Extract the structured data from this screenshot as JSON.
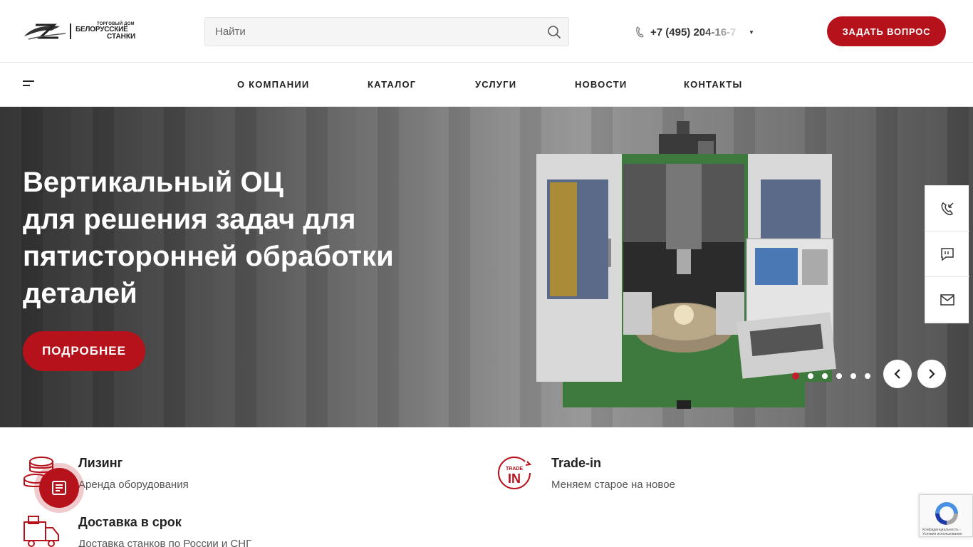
{
  "header": {
    "logo": {
      "small": "ТОРГОВЫЙ ДОМ",
      "line1": "БЕЛОРУССКИЕ",
      "line2": "СТАНКИ"
    },
    "search": {
      "placeholder": "Найти"
    },
    "phone": "+7 (495) 204-16-7",
    "ask_button": "ЗАДАТЬ ВОПРОС"
  },
  "nav": {
    "items": [
      "О КОМПАНИИ",
      "КАТАЛОГ",
      "УСЛУГИ",
      "НОВОСТИ",
      "КОНТАКТЫ"
    ]
  },
  "hero": {
    "title_lines": [
      "Вертикальный ОЦ",
      "для решения задач для",
      "пятисторонней обработки",
      "деталей"
    ],
    "button": "ПОДРОБНЕЕ",
    "slide_count": 6,
    "active_slide": 1
  },
  "features": [
    {
      "title": "Лизинг",
      "subtitle": "Аренда оборудования",
      "icon": "coins-stack-icon"
    },
    {
      "title": "Trade-in",
      "subtitle": "Меняем старое на новое",
      "icon": "trade-in-icon",
      "icon_text": "TRADE IN"
    },
    {
      "title": "Доставка в срок",
      "subtitle": "Доставка станков по России и СНГ",
      "icon": "delivery-truck-icon"
    }
  ],
  "side_widget": [
    "callback-phone-icon",
    "chat-icon",
    "mail-icon"
  ],
  "recaptcha": {
    "text": "Конфиденциальность - Условия использования"
  },
  "colors": {
    "accent": "#b5121b",
    "text": "#222222"
  }
}
